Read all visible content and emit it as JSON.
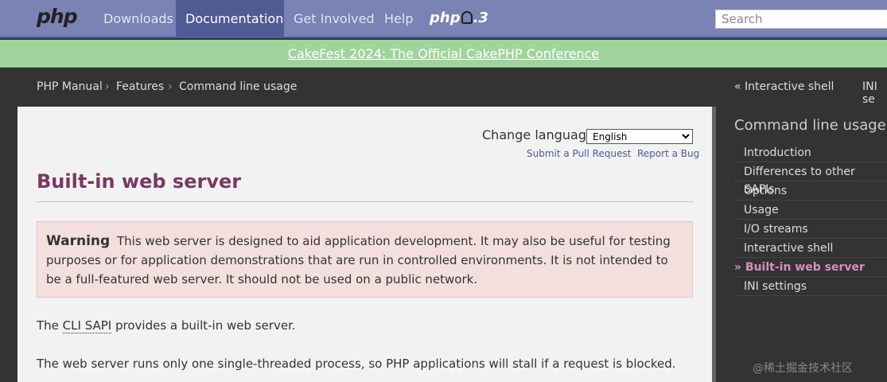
{
  "nav": {
    "logo": "php",
    "items": [
      "Downloads",
      "Documentation",
      "Get Involved",
      "Help"
    ],
    "version_prefix": "php",
    "version_suffix": ".3",
    "search_placeholder": "Search"
  },
  "banner": {
    "text": "CakeFest 2024: The Official CakePHP Conference"
  },
  "breadcrumb": {
    "items": [
      "PHP Manual",
      "Features",
      "Command line usage"
    ],
    "separator": "›",
    "prev": "« Interactive shell",
    "next": "INI se"
  },
  "main": {
    "change_language_label": "Change language:",
    "language_selected": "English",
    "submit_pr": "Submit a Pull Request",
    "report_bug": "Report a Bug",
    "title": "Built-in web server",
    "warning_title": "Warning",
    "warning_text": "This web server is designed to aid application development. It may also be useful for testing purposes or for application demonstrations that are run in controlled environments. It is not intended to be a full-featured web server. It should not be used on a public network.",
    "para1_before": "The ",
    "para1_abbr": "CLI SAPI",
    "para1_after": " provides a built-in web server.",
    "para2": "The web server runs only one single-threaded process, so PHP applications will stall if a request is blocked."
  },
  "sidebar": {
    "title": "Command line usage",
    "items": [
      "Introduction",
      "Differences to other SAPIs",
      "Options",
      "Usage",
      "I/O streams",
      "Interactive shell",
      "» Built-in web server",
      "INI settings"
    ],
    "current_index": 6
  },
  "watermark": "@稀土掘金技术社区",
  "colors": {
    "nav_bg": "#7b82b4",
    "nav_active": "#4f5b93",
    "banner_bg": "#9fd59c",
    "title": "#793862",
    "sidebar_current": "#d68fbe"
  }
}
